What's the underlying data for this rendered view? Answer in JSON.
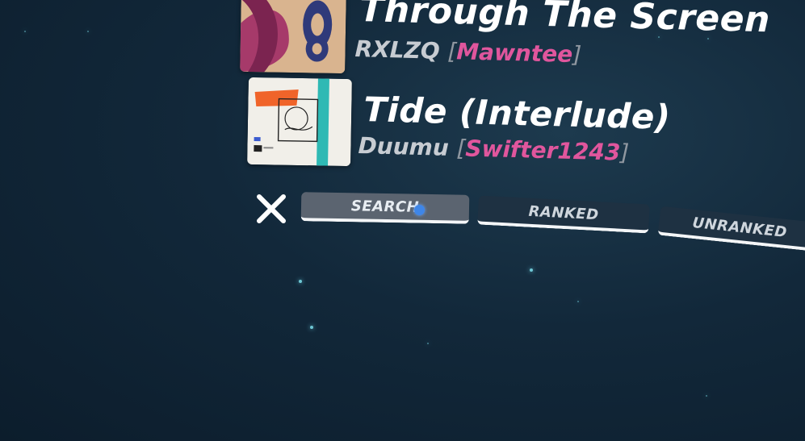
{
  "songs": [
    {
      "title": "Through The Screen",
      "artist": "RXLZQ",
      "mapper": "Mawntee",
      "cover_icon": "cover-art-through-the-screen"
    },
    {
      "title": "Tide (Interlude)",
      "artist": "Duumu",
      "mapper": "Swifter1243",
      "cover_icon": "cover-art-tide"
    }
  ],
  "brackets": {
    "open": "[",
    "close": "]"
  },
  "tabs": {
    "search": "SEARCH",
    "ranked": "RANKED",
    "unranked": "UNRANKED"
  },
  "close_icon": "close-icon",
  "colors": {
    "mapper": "#e0569d",
    "active_tab": "#5b6470",
    "inactive_tab": "#1e3142",
    "cursor": "#3e86e8"
  }
}
